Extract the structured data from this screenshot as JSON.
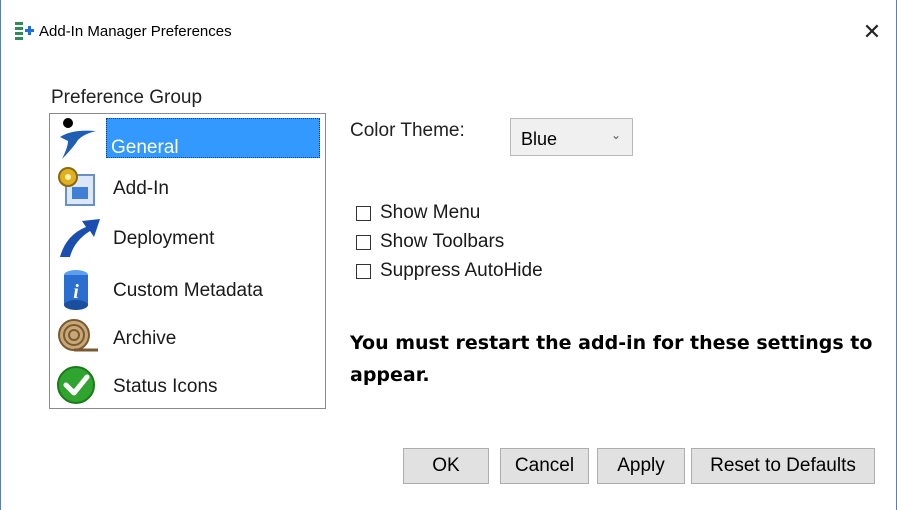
{
  "window": {
    "title": "Add-In Manager Preferences",
    "close_glyph": "✕"
  },
  "preference_group": {
    "label": "Preference Group",
    "items": [
      {
        "label": "General",
        "icon": "general-icon",
        "selected": true
      },
      {
        "label": "Add-In",
        "icon": "add-in-icon",
        "selected": false
      },
      {
        "label": "Deployment",
        "icon": "deployment-icon",
        "selected": false
      },
      {
        "label": "Custom Metadata",
        "icon": "custom-metadata-icon",
        "selected": false
      },
      {
        "label": "Archive",
        "icon": "archive-icon",
        "selected": false
      },
      {
        "label": "Status Icons",
        "icon": "status-icons-icon",
        "selected": false
      }
    ]
  },
  "color_theme": {
    "label": "Color Theme:",
    "value": "Blue"
  },
  "options": [
    {
      "label": "Show Menu",
      "checked": false
    },
    {
      "label": "Show Toolbars",
      "checked": false
    },
    {
      "label": "Suppress AutoHide",
      "checked": false
    }
  ],
  "notice": "You must restart the add-in for these settings to appear.",
  "buttons": {
    "ok": "OK",
    "cancel": "Cancel",
    "apply": "Apply",
    "reset": "Reset to Defaults"
  },
  "colors": {
    "selection": "#3399ff",
    "window_border": "#5b7fb0",
    "button_face": "#e1e1e1"
  }
}
